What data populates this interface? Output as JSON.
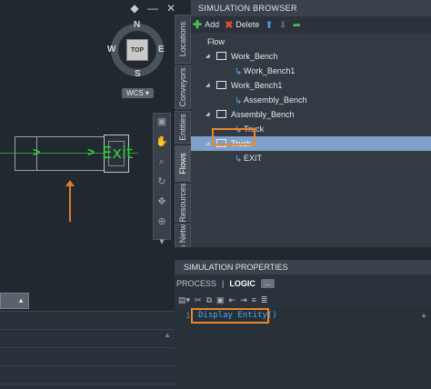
{
  "viewport": {
    "window_controls": [
      "◆",
      "—",
      "✕"
    ],
    "viewcube": {
      "face": "TOP",
      "north": "N",
      "south": "S",
      "east": "E",
      "west": "W"
    },
    "wcs_label": "WCS",
    "exit_label": "Exit",
    "flow_arrows": [
      ">",
      ">"
    ],
    "nav_buttons": [
      "▣",
      "✋",
      "⌕",
      "↻",
      "✥",
      "⊕",
      "▾"
    ],
    "cmd_tab_arrow": "▲",
    "cmd_scroll_arrow": "▲"
  },
  "vertical_tabs": [
    "Locations",
    "Conveyors",
    "Entities",
    "Flows",
    "Resources",
    "Path Networks"
  ],
  "browser": {
    "title": "SIMULATION BROWSER",
    "toolbar": {
      "add": "Add",
      "delete": "Delete"
    },
    "tree": [
      {
        "label": "Flow",
        "level": 0,
        "caret": "◢",
        "icon": "none"
      },
      {
        "label": "Work_Bench",
        "level": 1,
        "caret": "◢",
        "icon": "box"
      },
      {
        "label": "Work_Bench1",
        "level": 2,
        "caret": "",
        "icon": "link"
      },
      {
        "label": "Work_Bench1",
        "level": 1,
        "caret": "◢",
        "icon": "box"
      },
      {
        "label": "Assembly_Bench",
        "level": 2,
        "caret": "",
        "icon": "link"
      },
      {
        "label": "Assembly_Bench",
        "level": 1,
        "caret": "◢",
        "icon": "box"
      },
      {
        "label": "Truck",
        "level": 2,
        "caret": "",
        "icon": "link"
      },
      {
        "label": "Truck",
        "level": 1,
        "caret": "◢",
        "icon": "box",
        "selected": true
      },
      {
        "label": "EXIT",
        "level": 2,
        "caret": "",
        "icon": "link"
      }
    ]
  },
  "properties": {
    "title": "SIMULATION PROPERTIES",
    "tabs": {
      "process": "PROCESS",
      "separator": "|",
      "logic": "LOGIC",
      "more": "..."
    },
    "line_number": "1",
    "code": "Display Entity()",
    "scroll_arrow": "▲"
  },
  "colors": {
    "accent_highlight": "#e8882a",
    "selection": "#7fa1c9",
    "flow_green": "#2fd13a",
    "code_blue": "#4aa8ff"
  }
}
